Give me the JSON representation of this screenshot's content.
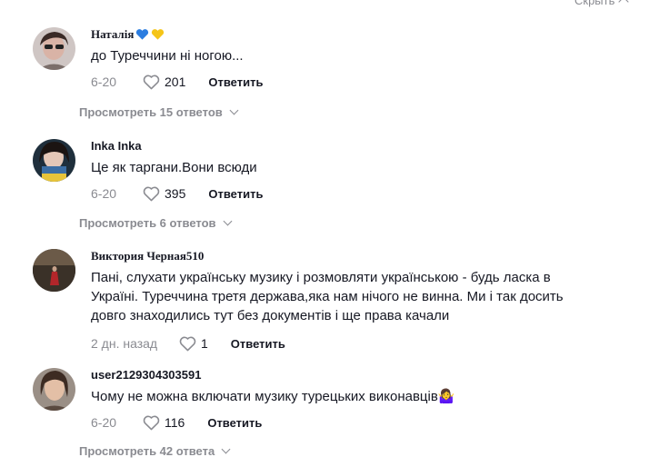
{
  "header": {
    "hide_label": "Скрыть"
  },
  "comments": [
    {
      "username": "Наталія",
      "text": "до Туреччини ні ногою...",
      "date": "6-20",
      "likes": "201",
      "reply_label": "Ответить",
      "view_replies": "Просмотреть 15 ответов",
      "heart_colors": [
        "#2b7de0",
        "#f5c518"
      ]
    },
    {
      "username": "Inka Inka",
      "text": "Це як таргани.Вони всюди",
      "date": "6-20",
      "likes": "395",
      "reply_label": "Ответить",
      "view_replies": "Просмотреть 6 ответов"
    },
    {
      "username": "Виктория Черная510",
      "text": "Пані, слухати українську музику і розмовляти українською - будь ласка в Україні. Туреччина третя держава,яка нам нічого не винна. Ми і так досить довго знаходились тут без документів і ще права качали",
      "date": "2 дн. назад",
      "likes": "1",
      "reply_label": "Ответить"
    },
    {
      "username": "user2129304303591",
      "text": "Чому не можна включати музику турецьких виконавців",
      "emoji": "🤷‍♀️",
      "date": "6-20",
      "likes": "116",
      "reply_label": "Ответить",
      "view_replies": "Просмотреть 42 ответа"
    }
  ]
}
